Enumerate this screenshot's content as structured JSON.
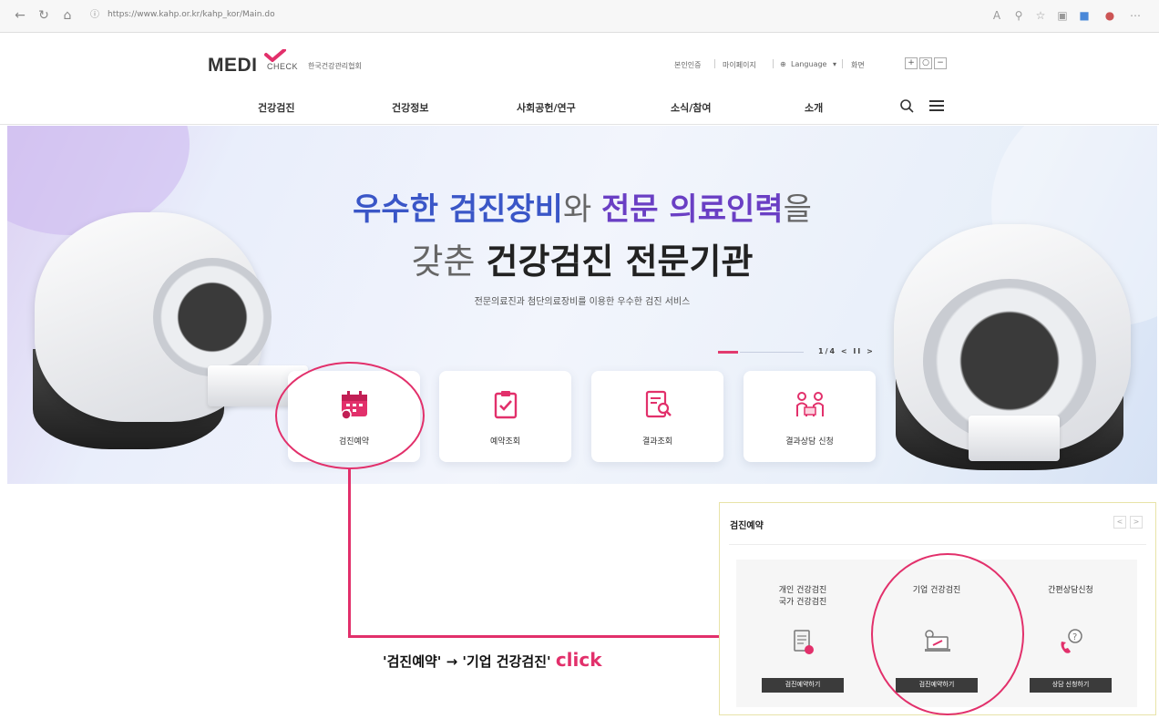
{
  "browser": {
    "url": "https://www.kahp.or.kr/kahp_kor/Main.do"
  },
  "header": {
    "logo_main": "MEDI",
    "logo_check": "CHECK",
    "logo_sub": "한국건강관리협회",
    "util_links": [
      "본인인증",
      "마이페이지",
      "Language",
      "화면"
    ],
    "zoom_controls": [
      "+",
      "○",
      "−"
    ]
  },
  "gnb": {
    "items": [
      "건강검진",
      "건강정보",
      "사회공헌/연구",
      "소식/참여",
      "소개"
    ]
  },
  "hero": {
    "line1_a": "우수한 검진장비",
    "line1_b": "와 ",
    "line1_c": "전문 의료인력",
    "line1_d": "을",
    "line2_a": "갖춘 ",
    "line2_b": "건강검진 전문기관",
    "subtitle": "전문의료진과 첨단의료장비를 이용한 우수한 검진 서비스",
    "slide_counter": "1/4 < II >"
  },
  "quick_menu": [
    {
      "label": "검진예약",
      "icon": "calendar-icon"
    },
    {
      "label": "예약조회",
      "icon": "clipboard-check-icon"
    },
    {
      "label": "결과조회",
      "icon": "document-search-icon"
    },
    {
      "label": "결과상담 신청",
      "icon": "consultation-icon"
    }
  ],
  "annotation": {
    "text": "'검진예약' → '기업 건강검진' ",
    "click": "click",
    "color": "#e2306b"
  },
  "panel": {
    "title": "검진예약",
    "nav_prev": "<",
    "nav_next": ">",
    "options": [
      {
        "title": "개인 건강검진\n국가 건강검진",
        "button": "검진예약하기",
        "icon": "document-pen-icon"
      },
      {
        "title": "기업 건강검진",
        "button": "검진예약하기",
        "icon": "laptop-icon"
      },
      {
        "title": "간편상담신청",
        "button": "상담 신청하기",
        "icon": "phone-question-icon"
      }
    ]
  },
  "colors": {
    "accent": "#e2306b",
    "hero_blue": "#3a56c7",
    "hero_purple": "#6a3fc4"
  }
}
